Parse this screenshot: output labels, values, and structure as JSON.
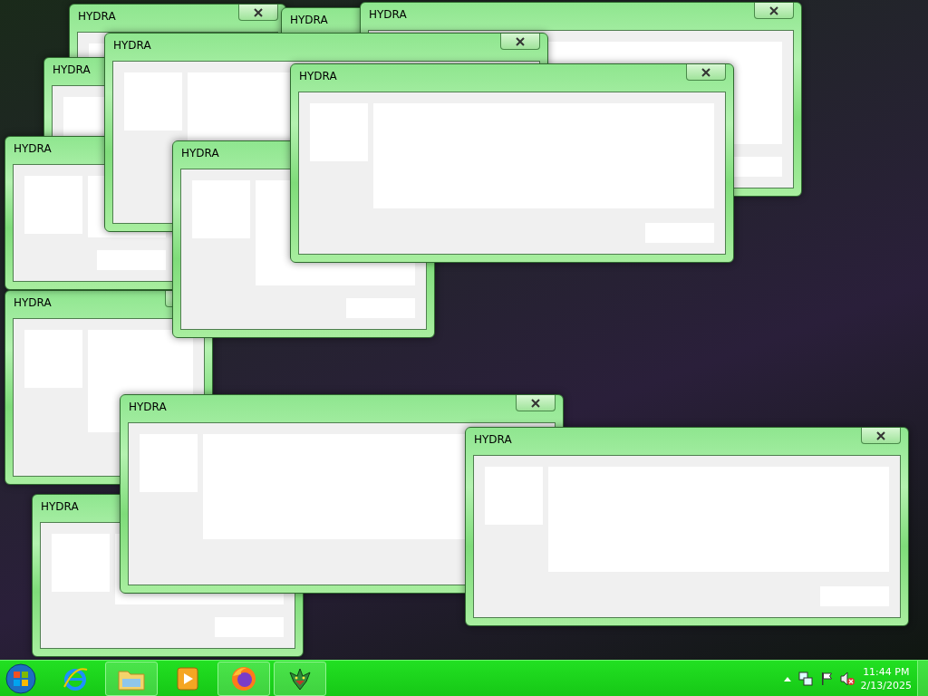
{
  "windows": [
    {
      "title": "HYDRA"
    },
    {
      "title": "HYDRA"
    },
    {
      "title": "HYDRA"
    },
    {
      "title": "HYDRA"
    },
    {
      "title": "HYDRA"
    },
    {
      "title": "HYDRA"
    },
    {
      "title": "HYDRA"
    },
    {
      "title": "HYDRA"
    },
    {
      "title": "HYDRA"
    },
    {
      "title": "HYDRA"
    },
    {
      "title": "HYDRA"
    },
    {
      "title": "HYDRA"
    }
  ],
  "taskbar": {
    "items": [
      {
        "kind": "start",
        "running": false
      },
      {
        "kind": "browser",
        "running": false
      },
      {
        "kind": "folder",
        "running": true
      },
      {
        "kind": "media",
        "running": false
      },
      {
        "kind": "firefox",
        "running": true
      },
      {
        "kind": "dragon",
        "running": true
      }
    ],
    "tray": {
      "time": "11:44 PM",
      "date": "2/13/2025"
    }
  }
}
